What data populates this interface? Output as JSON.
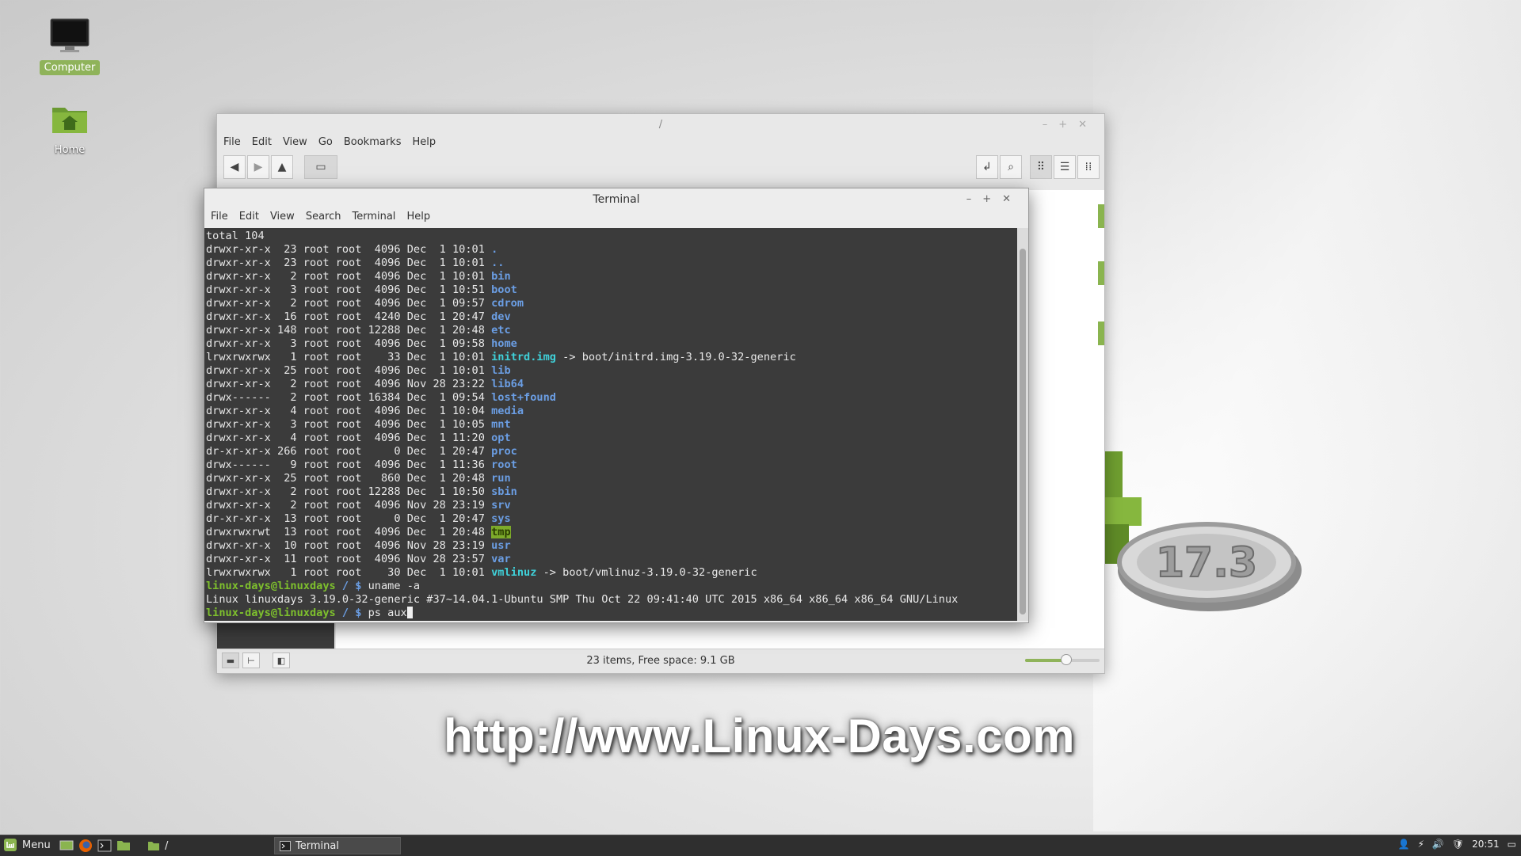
{
  "desktop": {
    "icons": [
      {
        "label": "Computer",
        "icon": "monitor-icon",
        "selected": true
      },
      {
        "label": "Home",
        "icon": "home-folder-icon",
        "selected": false
      }
    ],
    "watermark": "http://www.Linux-Days.com",
    "logo_text": "17.3"
  },
  "file_manager": {
    "title": "/",
    "menu": [
      "File",
      "Edit",
      "View",
      "Go",
      "Bookmarks",
      "Help"
    ],
    "status": "23 items, Free space: 9.1 GB",
    "zoom_level": 0.55
  },
  "terminal": {
    "title": "Terminal",
    "menu": [
      "File",
      "Edit",
      "View",
      "Search",
      "Terminal",
      "Help"
    ],
    "lines": [
      [
        {
          "t": "total 104"
        }
      ],
      [
        {
          "t": "drwxr-xr-x  23 root root  4096 Dec  1 10:01 "
        },
        {
          "t": ".",
          "c": "dir"
        }
      ],
      [
        {
          "t": "drwxr-xr-x  23 root root  4096 Dec  1 10:01 "
        },
        {
          "t": "..",
          "c": "dir"
        }
      ],
      [
        {
          "t": "drwxr-xr-x   2 root root  4096 Dec  1 10:01 "
        },
        {
          "t": "bin",
          "c": "dir"
        }
      ],
      [
        {
          "t": "drwxr-xr-x   3 root root  4096 Dec  1 10:51 "
        },
        {
          "t": "boot",
          "c": "dir"
        }
      ],
      [
        {
          "t": "drwxr-xr-x   2 root root  4096 Dec  1 09:57 "
        },
        {
          "t": "cdrom",
          "c": "dir"
        }
      ],
      [
        {
          "t": "drwxr-xr-x  16 root root  4240 Dec  1 20:47 "
        },
        {
          "t": "dev",
          "c": "dir"
        }
      ],
      [
        {
          "t": "drwxr-xr-x 148 root root 12288 Dec  1 20:48 "
        },
        {
          "t": "etc",
          "c": "dir"
        }
      ],
      [
        {
          "t": "drwxr-xr-x   3 root root  4096 Dec  1 09:58 "
        },
        {
          "t": "home",
          "c": "dir"
        }
      ],
      [
        {
          "t": "lrwxrwxrwx   1 root root    33 Dec  1 10:01 "
        },
        {
          "t": "initrd.img",
          "c": "link"
        },
        {
          "t": " -> boot/initrd.img-3.19.0-32-generic"
        }
      ],
      [
        {
          "t": "drwxr-xr-x  25 root root  4096 Dec  1 10:01 "
        },
        {
          "t": "lib",
          "c": "dir"
        }
      ],
      [
        {
          "t": "drwxr-xr-x   2 root root  4096 Nov 28 23:22 "
        },
        {
          "t": "lib64",
          "c": "dir"
        }
      ],
      [
        {
          "t": "drwx------   2 root root 16384 Dec  1 09:54 "
        },
        {
          "t": "lost+found",
          "c": "dir"
        }
      ],
      [
        {
          "t": "drwxr-xr-x   4 root root  4096 Dec  1 10:04 "
        },
        {
          "t": "media",
          "c": "dir"
        }
      ],
      [
        {
          "t": "drwxr-xr-x   3 root root  4096 Dec  1 10:05 "
        },
        {
          "t": "mnt",
          "c": "dir"
        }
      ],
      [
        {
          "t": "drwxr-xr-x   4 root root  4096 Dec  1 11:20 "
        },
        {
          "t": "opt",
          "c": "dir"
        }
      ],
      [
        {
          "t": "dr-xr-xr-x 266 root root     0 Dec  1 20:47 "
        },
        {
          "t": "proc",
          "c": "dir"
        }
      ],
      [
        {
          "t": "drwx------   9 root root  4096 Dec  1 11:36 "
        },
        {
          "t": "root",
          "c": "dir"
        }
      ],
      [
        {
          "t": "drwxr-xr-x  25 root root   860 Dec  1 20:48 "
        },
        {
          "t": "run",
          "c": "dir"
        }
      ],
      [
        {
          "t": "drwxr-xr-x   2 root root 12288 Dec  1 10:50 "
        },
        {
          "t": "sbin",
          "c": "dir"
        }
      ],
      [
        {
          "t": "drwxr-xr-x   2 root root  4096 Nov 28 23:19 "
        },
        {
          "t": "srv",
          "c": "dir"
        }
      ],
      [
        {
          "t": "dr-xr-xr-x  13 root root     0 Dec  1 20:47 "
        },
        {
          "t": "sys",
          "c": "dir"
        }
      ],
      [
        {
          "t": "drwxrwxrwt  13 root root  4096 Dec  1 20:48 "
        },
        {
          "t": "tmp",
          "c": "tmp"
        }
      ],
      [
        {
          "t": "drwxr-xr-x  10 root root  4096 Nov 28 23:19 "
        },
        {
          "t": "usr",
          "c": "dir"
        }
      ],
      [
        {
          "t": "drwxr-xr-x  11 root root  4096 Nov 28 23:57 "
        },
        {
          "t": "var",
          "c": "dir"
        }
      ],
      [
        {
          "t": "lrwxrwxrwx   1 root root    30 Dec  1 10:01 "
        },
        {
          "t": "vmlinuz",
          "c": "link"
        },
        {
          "t": " -> boot/vmlinuz-3.19.0-32-generic"
        }
      ],
      [
        {
          "t": "linux-days@linuxdays",
          "c": "prompt"
        },
        {
          "t": " / $",
          "c": "path"
        },
        {
          "t": " uname -a"
        }
      ],
      [
        {
          "t": "Linux linuxdays 3.19.0-32-generic #37~14.04.1-Ubuntu SMP Thu Oct 22 09:41:40 UTC 2015 x86_64 x86_64 x86_64 GNU/Linux"
        }
      ],
      [
        {
          "t": "linux-days@linuxdays",
          "c": "prompt"
        },
        {
          "t": " / $",
          "c": "path"
        },
        {
          "t": " ps aux"
        },
        {
          "t": "",
          "c": "cursor"
        }
      ]
    ]
  },
  "taskbar": {
    "menu_label": "Menu",
    "tasks": [
      {
        "label": "/",
        "icon": "folder-icon",
        "active": false
      },
      {
        "label": "Terminal",
        "icon": "terminal-icon",
        "active": true
      }
    ],
    "clock": "20:51"
  }
}
